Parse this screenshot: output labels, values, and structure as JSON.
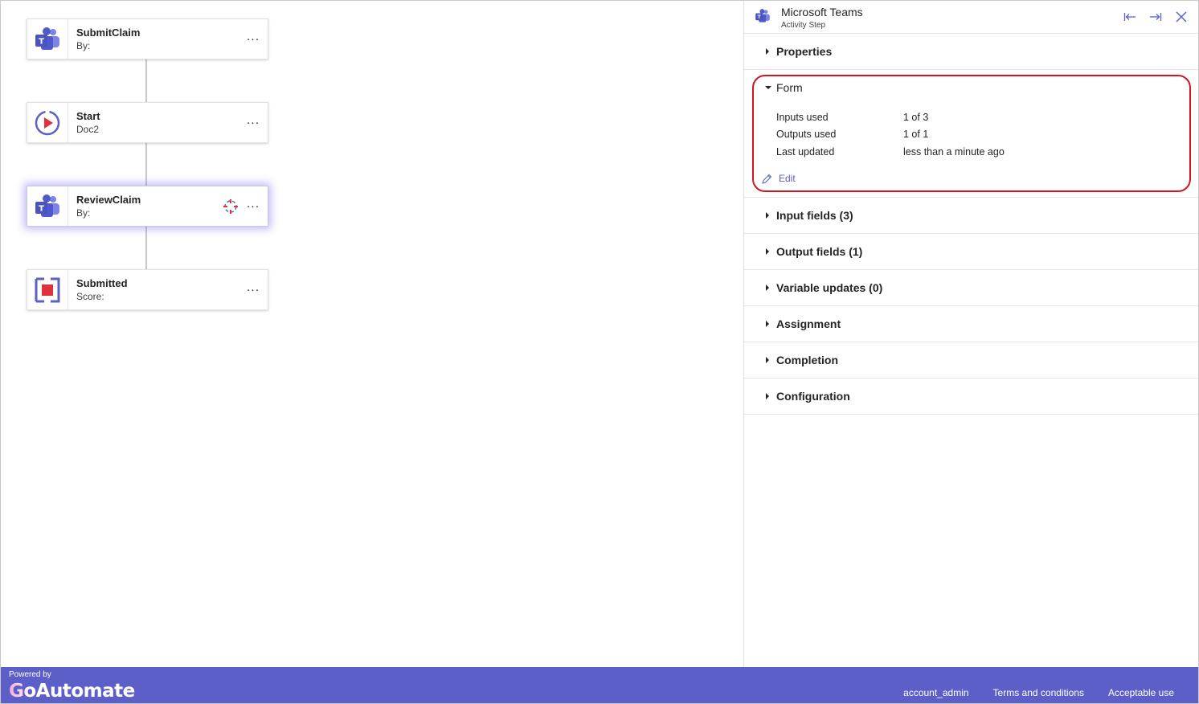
{
  "canvas": {
    "nodes": [
      {
        "title": "SubmitClaim",
        "subtitle": "By:",
        "icon": "teams-icon"
      },
      {
        "title": "Start",
        "subtitle": "Doc2",
        "icon": "start-play-icon"
      },
      {
        "title": "ReviewClaim",
        "subtitle": "By:",
        "icon": "teams-icon"
      },
      {
        "title": "Submitted",
        "subtitle": "Score:",
        "icon": "stop-square-icon"
      }
    ],
    "more_label": "..."
  },
  "panel": {
    "title": "Microsoft Teams",
    "subtitle": "Activity Step",
    "sections": {
      "properties": "Properties",
      "form": "Form",
      "input_fields": "Input fields (3)",
      "output_fields": "Output fields (1)",
      "variable_updates": "Variable updates (0)",
      "assignment": "Assignment",
      "completion": "Completion",
      "configuration": "Configuration"
    },
    "form": {
      "rows": [
        {
          "label": "Inputs used",
          "value": "1 of 3"
        },
        {
          "label": "Outputs used",
          "value": "1 of 1"
        },
        {
          "label": "Last updated",
          "value": "less than a minute ago"
        }
      ],
      "edit_label": "Edit"
    }
  },
  "footer": {
    "powered_by": "Powered by",
    "brand": "GoAutomate",
    "links": [
      "account_admin",
      "Terms and conditions",
      "Acceptable use"
    ]
  },
  "colors": {
    "accent": "#5b5fc7",
    "highlight": "#d4151f",
    "teams_purple": "#5059c9"
  }
}
